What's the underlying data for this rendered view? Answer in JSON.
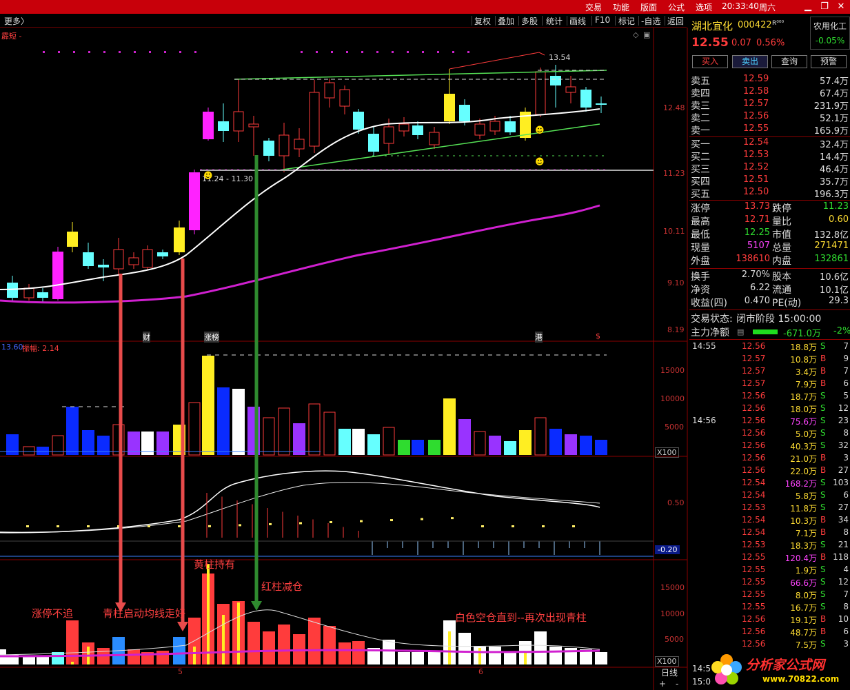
{
  "topbar": {
    "menus": [
      "交易",
      "功能",
      "版面",
      "公式",
      "选项"
    ],
    "time": "20:33:40",
    "weekday": "周六",
    "win_min": "▁",
    "win_max": "❐",
    "win_close": "✕"
  },
  "toolbar": {
    "more": "更多〉",
    "buttons": [
      "复权",
      "叠加",
      "多股",
      "统计",
      "画线",
      "F10",
      "标记",
      "-自选",
      "返回"
    ]
  },
  "main_chart": {
    "corner_label": "霹短 -",
    "price_labels": [
      "12.48",
      "11.23",
      "10.11",
      "9.10",
      "8.19"
    ],
    "high_label": "13.54",
    "range_label": "11.24 - 11.30",
    "event_labels": [
      "财",
      "涨榜",
      "港",
      "$"
    ]
  },
  "volume_panel": {
    "header_left": "13.60",
    "header_amp": "振幅: 2.14",
    "axis": [
      "15000",
      "10000",
      "5000"
    ],
    "unit": "X100"
  },
  "macd_panel": {
    "axis": [
      "0.50"
    ],
    "axis_low": "-0.20"
  },
  "signal_panel": {
    "axis": [
      "15000",
      "10000",
      "5000"
    ],
    "unit": "X100",
    "date_marks": [
      "5",
      "6"
    ],
    "period": "日线",
    "annotations": {
      "zt_buzhui": "涨停不追",
      "qingzhu": "青柱启动均线走好",
      "huangzhu": "黄柱持有",
      "hongzhu": "红柱减仓",
      "baise": "白色空仓直到--再次出现青柱"
    }
  },
  "stock": {
    "name": "湖北宜化",
    "code": "000422",
    "flags": "R⁰⁰⁰",
    "sector": "农用化工",
    "sector_change": "-0.05%",
    "price": "12.55",
    "change": "0.07",
    "change_pct": "0.56%",
    "buttons": [
      "买入",
      "卖出",
      "查询",
      "预警"
    ]
  },
  "asks": [
    {
      "label": "卖五",
      "price": "12.59",
      "vol": "57.4万"
    },
    {
      "label": "卖四",
      "price": "12.58",
      "vol": "67.4万"
    },
    {
      "label": "卖三",
      "price": "12.57",
      "vol": "231.9万"
    },
    {
      "label": "卖二",
      "price": "12.56",
      "vol": "52.1万"
    },
    {
      "label": "卖一",
      "price": "12.55",
      "vol": "165.9万"
    }
  ],
  "bids": [
    {
      "label": "买一",
      "price": "12.54",
      "vol": "32.4万"
    },
    {
      "label": "买二",
      "price": "12.53",
      "vol": "14.4万"
    },
    {
      "label": "买三",
      "price": "12.52",
      "vol": "46.4万"
    },
    {
      "label": "买四",
      "price": "12.51",
      "vol": "35.7万"
    },
    {
      "label": "买五",
      "price": "12.50",
      "vol": "196.3万"
    }
  ],
  "stats": [
    {
      "l1": "涨停",
      "v1": "13.73",
      "l2": "跌停",
      "v2": "11.23"
    },
    {
      "l1": "最高",
      "v1": "12.71",
      "l2": "量比",
      "v2": "0.60"
    },
    {
      "l1": "最低",
      "v1": "12.25",
      "l2": "市值",
      "v2": "132.8亿"
    },
    {
      "l1": "现量",
      "v1": "5107",
      "l2": "总量",
      "v2": "271471"
    },
    {
      "l1": "外盘",
      "v1": "138610",
      "l2": "内盘",
      "v2": "132861"
    }
  ],
  "stats2": [
    {
      "l1": "换手",
      "v1": "2.70%",
      "l2": "股本",
      "v2": "10.6亿"
    },
    {
      "l1": "净资",
      "v1": "6.22",
      "l2": "流通",
      "v2": "10.1亿"
    },
    {
      "l1": "收益(四)",
      "v1": "0.470",
      "l2": "PE(动)",
      "v2": "29.3"
    }
  ],
  "status": {
    "label": "交易状态:",
    "value": "闭市阶段 15:00:00",
    "flow_label": "主力净额",
    "flow_value": "-671.0万",
    "flow_pct": "-2%"
  },
  "ticks": [
    {
      "time": "14:55",
      "price": "12.56",
      "vol": "18.8万",
      "side": "S",
      "n": "7"
    },
    {
      "time": "",
      "price": "12.57",
      "vol": "10.8万",
      "side": "B",
      "n": "9"
    },
    {
      "time": "",
      "price": "12.57",
      "vol": "3.4万",
      "side": "B",
      "n": "7"
    },
    {
      "time": "",
      "price": "12.57",
      "vol": "7.9万",
      "side": "B",
      "n": "6"
    },
    {
      "time": "",
      "price": "12.56",
      "vol": "18.7万",
      "side": "S",
      "n": "5"
    },
    {
      "time": "",
      "price": "12.56",
      "vol": "18.0万",
      "side": "S",
      "n": "12"
    },
    {
      "time": "14:56",
      "price": "12.56",
      "vol": "75.6万",
      "side": "S",
      "n": "23"
    },
    {
      "time": "",
      "price": "12.56",
      "vol": "5.0万",
      "side": "S",
      "n": "8"
    },
    {
      "time": "",
      "price": "12.56",
      "vol": "40.3万",
      "side": "S",
      "n": "32"
    },
    {
      "time": "",
      "price": "12.56",
      "vol": "21.0万",
      "side": "B",
      "n": "3"
    },
    {
      "time": "",
      "price": "12.56",
      "vol": "22.0万",
      "side": "B",
      "n": "27"
    },
    {
      "time": "",
      "price": "12.54",
      "vol": "168.2万",
      "side": "S",
      "n": "103"
    },
    {
      "time": "",
      "price": "12.54",
      "vol": "5.8万",
      "side": "S",
      "n": "6"
    },
    {
      "time": "",
      "price": "12.53",
      "vol": "11.8万",
      "side": "S",
      "n": "27"
    },
    {
      "time": "",
      "price": "12.54",
      "vol": "10.3万",
      "side": "B",
      "n": "34"
    },
    {
      "time": "",
      "price": "12.54",
      "vol": "7.1万",
      "side": "B",
      "n": "8"
    },
    {
      "time": "",
      "price": "12.53",
      "vol": "18.3万",
      "side": "S",
      "n": "21"
    },
    {
      "time": "",
      "price": "12.55",
      "vol": "120.4万",
      "side": "B",
      "n": "118"
    },
    {
      "time": "",
      "price": "12.55",
      "vol": "1.9万",
      "side": "S",
      "n": "4"
    },
    {
      "time": "",
      "price": "12.55",
      "vol": "66.6万",
      "side": "S",
      "n": "12"
    },
    {
      "time": "",
      "price": "12.55",
      "vol": "8.0万",
      "side": "S",
      "n": "7"
    },
    {
      "time": "",
      "price": "12.55",
      "vol": "16.7万",
      "side": "S",
      "n": "8"
    },
    {
      "time": "",
      "price": "12.56",
      "vol": "19.1万",
      "side": "B",
      "n": "10"
    },
    {
      "time": "",
      "price": "12.56",
      "vol": "48.7万",
      "side": "B",
      "n": "6"
    },
    {
      "time": "",
      "price": "12.56",
      "vol": "7.5万",
      "side": "S",
      "n": "3"
    }
  ],
  "tick_partial_times": [
    "14:5",
    "15:0"
  ],
  "watermark": {
    "name": "分析家公式网",
    "url": "www.70822.com"
  },
  "colors": {
    "up": "#ff3c3c",
    "down": "#2fdc2f",
    "ma_white": "#ffffff",
    "ma_magenta": "#e030e0",
    "cyan_candle": "#66ffff",
    "magenta_candle": "#ff22ff",
    "yellow_bar": "#ffee22",
    "blue_bar": "#0a2bff",
    "purple_bar": "#9933ff"
  }
}
